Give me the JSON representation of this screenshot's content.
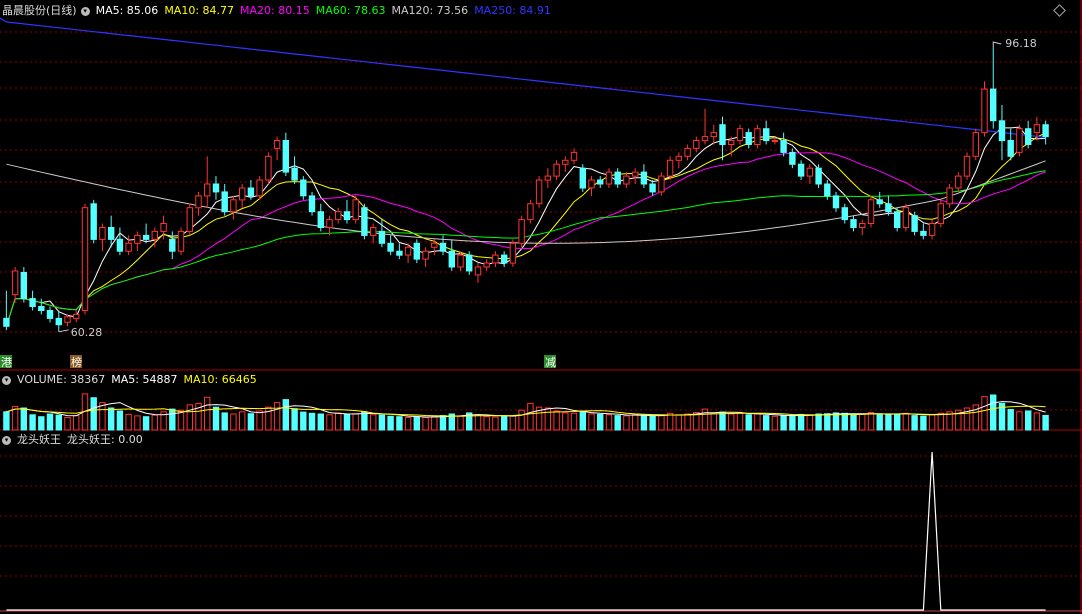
{
  "header": {
    "stock_name": "晶晨股份(日线)",
    "ma": [
      {
        "label": "MA5: 85.06",
        "color": "#ffffff"
      },
      {
        "label": "MA10: 84.77",
        "color": "#ffff00"
      },
      {
        "label": "MA20: 80.15",
        "color": "#ff00ff"
      },
      {
        "label": "MA60: 78.63",
        "color": "#00ff00"
      },
      {
        "label": "MA120: 73.56",
        "color": "#cccccc"
      },
      {
        "label": "MA250: 84.91",
        "color": "#3333ff"
      }
    ]
  },
  "volume_header": {
    "label": "VOLUME: 38367",
    "ma5": "MA5: 54887",
    "ma10": "MA10: 66465"
  },
  "indicator_header": {
    "name": "龙头妖王",
    "value": "龙头妖王: 0.00"
  },
  "price_labels": {
    "high": "96.18",
    "low": "60.28"
  },
  "markers": [
    "港",
    "榜",
    "减"
  ],
  "colors": {
    "up": "#ff3232",
    "down": "#54ffff",
    "grid": "#8b0000",
    "border": "#b00000"
  },
  "chart_data": {
    "type": "candlestick",
    "ylim": [
      58,
      100
    ],
    "candles": [
      [
        62.0,
        65.5,
        60.5,
        61.0
      ],
      [
        65.0,
        68.5,
        64.0,
        68.0
      ],
      [
        67.8,
        68.5,
        64.0,
        64.5
      ],
      [
        64.5,
        65.5,
        63.0,
        63.5
      ],
      [
        63.5,
        64.5,
        62.5,
        63.0
      ],
      [
        63.0,
        63.5,
        61.5,
        62.0
      ],
      [
        62.0,
        63.0,
        60.3,
        61.2
      ],
      [
        61.5,
        62.5,
        61.0,
        62.2
      ],
      [
        62.0,
        63.0,
        61.5,
        62.5
      ],
      [
        63.0,
        76.5,
        62.5,
        76.0
      ],
      [
        76.5,
        77.0,
        71.5,
        72.0
      ],
      [
        72.0,
        74.0,
        70.5,
        73.5
      ],
      [
        73.5,
        75.0,
        71.0,
        72.0
      ],
      [
        72.0,
        73.5,
        70.0,
        70.5
      ],
      [
        70.5,
        72.5,
        70.0,
        71.5
      ],
      [
        71.5,
        73.0,
        70.5,
        72.5
      ],
      [
        72.5,
        74.0,
        71.5,
        72.0
      ],
      [
        72.0,
        73.5,
        71.0,
        73.0
      ],
      [
        73.0,
        75.0,
        72.0,
        74.0
      ],
      [
        72.0,
        73.0,
        69.5,
        70.5
      ],
      [
        70.5,
        73.5,
        70.0,
        73.0
      ],
      [
        73.0,
        76.5,
        72.5,
        76.0
      ],
      [
        76.0,
        78.0,
        75.0,
        77.5
      ],
      [
        77.5,
        82.5,
        76.0,
        79.0
      ],
      [
        79.0,
        80.0,
        77.0,
        78.0
      ],
      [
        78.0,
        79.0,
        75.0,
        75.5
      ],
      [
        75.5,
        77.5,
        74.5,
        77.0
      ],
      [
        77.0,
        79.0,
        76.0,
        78.5
      ],
      [
        78.5,
        79.5,
        77.0,
        77.5
      ],
      [
        77.5,
        80.0,
        77.0,
        79.5
      ],
      [
        79.5,
        83.0,
        79.0,
        82.5
      ],
      [
        83.5,
        85.0,
        82.0,
        84.5
      ],
      [
        84.5,
        85.5,
        80.0,
        80.5
      ],
      [
        81.0,
        82.5,
        79.0,
        79.5
      ],
      [
        79.5,
        80.0,
        77.0,
        77.5
      ],
      [
        77.5,
        78.0,
        75.0,
        75.5
      ],
      [
        75.5,
        76.5,
        73.0,
        73.5
      ],
      [
        73.5,
        75.0,
        72.5,
        74.5
      ],
      [
        74.5,
        76.0,
        74.0,
        75.5
      ],
      [
        75.5,
        77.0,
        74.0,
        74.5
      ],
      [
        74.5,
        77.5,
        74.0,
        77.0
      ],
      [
        76.0,
        76.5,
        72.0,
        72.5
      ],
      [
        72.5,
        74.0,
        71.5,
        73.5
      ],
      [
        73.0,
        74.5,
        71.0,
        71.5
      ],
      [
        71.5,
        72.5,
        70.0,
        70.5
      ],
      [
        70.5,
        71.5,
        69.5,
        70.0
      ],
      [
        70.0,
        71.5,
        69.0,
        71.0
      ],
      [
        71.5,
        72.0,
        69.0,
        69.5
      ],
      [
        69.5,
        71.0,
        68.5,
        70.5
      ],
      [
        71.0,
        72.0,
        70.0,
        71.5
      ],
      [
        71.5,
        72.5,
        70.0,
        70.5
      ],
      [
        70.5,
        72.0,
        68.0,
        68.5
      ],
      [
        68.5,
        70.5,
        68.0,
        70.0
      ],
      [
        70.0,
        70.5,
        67.5,
        68.0
      ],
      [
        67.5,
        69.0,
        66.5,
        68.5
      ],
      [
        68.5,
        69.5,
        68.0,
        69.0
      ],
      [
        69.0,
        70.5,
        68.5,
        70.0
      ],
      [
        70.0,
        70.5,
        68.5,
        69.0
      ],
      [
        69.0,
        72.0,
        68.5,
        71.5
      ],
      [
        71.5,
        75.0,
        71.0,
        74.5
      ],
      [
        74.5,
        77.0,
        74.0,
        76.5
      ],
      [
        76.5,
        80.0,
        76.0,
        79.5
      ],
      [
        79.5,
        81.0,
        78.5,
        80.0
      ],
      [
        80.0,
        82.0,
        79.5,
        81.5
      ],
      [
        81.5,
        82.5,
        80.5,
        82.0
      ],
      [
        82.0,
        83.5,
        81.5,
        83.0
      ],
      [
        81.0,
        81.5,
        78.0,
        78.5
      ],
      [
        78.5,
        80.0,
        77.5,
        79.5
      ],
      [
        79.5,
        80.0,
        78.5,
        79.0
      ],
      [
        79.0,
        81.0,
        78.5,
        80.5
      ],
      [
        80.5,
        81.0,
        78.5,
        79.0
      ],
      [
        79.0,
        80.5,
        78.5,
        80.0
      ],
      [
        80.0,
        81.0,
        79.0,
        80.5
      ],
      [
        80.5,
        81.5,
        78.5,
        79.0
      ],
      [
        79.0,
        79.5,
        77.5,
        78.0
      ],
      [
        78.0,
        80.5,
        77.5,
        80.0
      ],
      [
        80.0,
        82.5,
        79.5,
        82.0
      ],
      [
        82.0,
        83.0,
        81.0,
        82.5
      ],
      [
        82.5,
        84.0,
        82.0,
        83.5
      ],
      [
        83.5,
        85.0,
        83.0,
        84.5
      ],
      [
        84.5,
        88.5,
        84.0,
        85.0
      ],
      [
        85.0,
        86.5,
        84.0,
        85.5
      ],
      [
        86.5,
        87.5,
        82.0,
        84.0
      ],
      [
        84.0,
        85.0,
        82.5,
        84.5
      ],
      [
        84.5,
        86.5,
        84.0,
        86.0
      ],
      [
        85.5,
        86.0,
        83.5,
        84.0
      ],
      [
        84.0,
        86.5,
        83.5,
        86.0
      ],
      [
        86.0,
        87.0,
        84.0,
        84.5
      ],
      [
        84.5,
        85.0,
        84.0,
        84.5
      ],
      [
        84.5,
        85.5,
        82.5,
        83.0
      ],
      [
        83.0,
        83.5,
        81.0,
        81.5
      ],
      [
        81.5,
        82.0,
        79.5,
        80.0
      ],
      [
        80.0,
        81.5,
        79.0,
        81.0
      ],
      [
        81.0,
        81.5,
        78.5,
        79.0
      ],
      [
        79.0,
        79.5,
        77.0,
        77.5
      ],
      [
        77.5,
        78.0,
        75.5,
        76.0
      ],
      [
        76.0,
        76.5,
        74.0,
        74.5
      ],
      [
        74.5,
        75.0,
        73.0,
        73.5
      ],
      [
        73.5,
        74.5,
        72.5,
        74.0
      ],
      [
        74.0,
        77.5,
        73.5,
        77.0
      ],
      [
        77.0,
        78.0,
        76.0,
        76.5
      ],
      [
        76.5,
        77.5,
        75.0,
        75.5
      ],
      [
        75.5,
        76.0,
        73.0,
        73.5
      ],
      [
        73.5,
        76.5,
        73.0,
        76.0
      ],
      [
        75.0,
        75.5,
        72.5,
        73.0
      ],
      [
        73.0,
        74.0,
        72.0,
        72.5
      ],
      [
        72.5,
        74.5,
        72.0,
        74.0
      ],
      [
        74.0,
        77.0,
        73.5,
        76.5
      ],
      [
        76.5,
        79.0,
        76.0,
        78.5
      ],
      [
        78.5,
        80.5,
        78.0,
        80.0
      ],
      [
        80.0,
        83.0,
        79.5,
        82.5
      ],
      [
        82.5,
        86.0,
        82.0,
        85.5
      ],
      [
        85.5,
        92.0,
        85.0,
        91.0
      ],
      [
        91.0,
        96.2,
        86.0,
        87.0
      ],
      [
        87.0,
        89.0,
        82.0,
        84.5
      ],
      [
        84.5,
        86.0,
        82.0,
        82.5
      ],
      [
        83.0,
        86.5,
        82.5,
        86.0
      ],
      [
        86.0,
        87.0,
        83.5,
        84.0
      ],
      [
        85.5,
        87.5,
        84.5,
        86.5
      ],
      [
        86.5,
        87.0,
        84.0,
        85.0
      ]
    ],
    "volume": [
      48000,
      62000,
      58000,
      40000,
      35000,
      42000,
      39000,
      33000,
      38000,
      95000,
      85000,
      72000,
      58000,
      50000,
      41000,
      37000,
      35000,
      39000,
      48000,
      55000,
      52000,
      66000,
      70000,
      86000,
      60000,
      45000,
      42000,
      48000,
      43000,
      50000,
      60000,
      72000,
      80000,
      56000,
      47000,
      44000,
      42000,
      40000,
      45000,
      41000,
      43000,
      48000,
      40000,
      39000,
      36000,
      35000,
      33000,
      34000,
      33000,
      36000,
      38000,
      42000,
      37000,
      45000,
      40000,
      35000,
      34000,
      36000,
      38000,
      52000,
      70000,
      60000,
      58000,
      50000,
      45000,
      44000,
      48000,
      42000,
      41000,
      40000,
      38000,
      37000,
      40000,
      39000,
      36000,
      38000,
      44000,
      40000,
      42000,
      46000,
      55000,
      43000,
      47000,
      42000,
      44000,
      40000,
      42000,
      38000,
      36000,
      37000,
      38000,
      41000,
      40000,
      42000,
      43000,
      45000,
      44000,
      40000,
      41000,
      46000,
      42000,
      40000,
      42000,
      44000,
      38000,
      36000,
      40000,
      44000,
      48000,
      52000,
      58000,
      66000,
      88000,
      92000,
      70000,
      54000,
      48000,
      50000,
      45000,
      38367
    ],
    "indicator": {
      "name": "龙头妖王",
      "spike_index": 106,
      "spike_value": 1,
      "baseline": 0
    }
  }
}
